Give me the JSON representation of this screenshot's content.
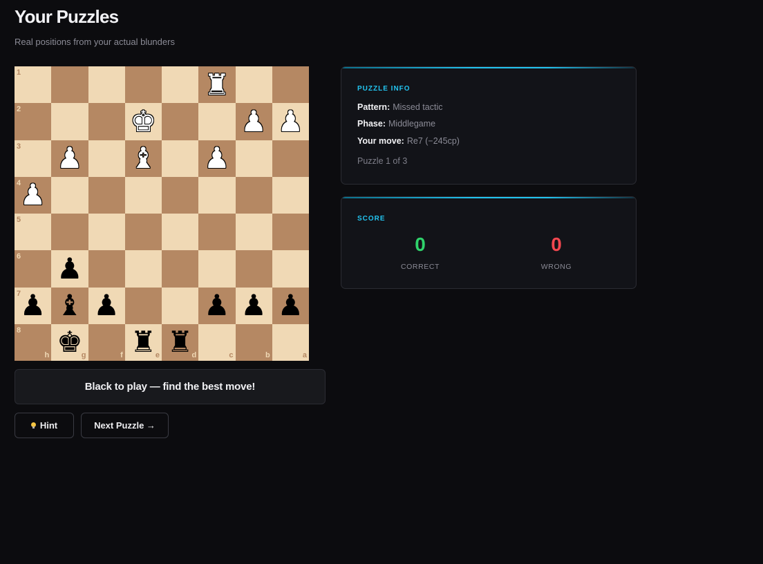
{
  "header": {
    "title": "Your Puzzles",
    "subtitle": "Real positions from your actual blunders"
  },
  "board": {
    "light_color": "#f0d9b5",
    "dark_color": "#b58863",
    "rank_labels": [
      "1",
      "2",
      "3",
      "4",
      "5",
      "6",
      "7",
      "8"
    ],
    "file_labels": [
      "h",
      "g",
      "f",
      "e",
      "d",
      "c",
      "b",
      "a"
    ],
    "rows": [
      [
        "",
        "",
        "",
        "",
        "",
        "wR",
        "",
        ""
      ],
      [
        "",
        "",
        "",
        "wK",
        "",
        "",
        "wP",
        "wP"
      ],
      [
        "",
        "wP",
        "",
        "wB",
        "",
        "wP",
        "",
        ""
      ],
      [
        "wP",
        "",
        "",
        "",
        "",
        "",
        "",
        ""
      ],
      [
        "",
        "",
        "",
        "",
        "",
        "",
        "",
        ""
      ],
      [
        "",
        "bP",
        "",
        "",
        "",
        "",
        "",
        ""
      ],
      [
        "bP",
        "bB",
        "bP",
        "",
        "",
        "bP",
        "bP",
        "bP"
      ],
      [
        "",
        "bK",
        "",
        "bR",
        "bR",
        "",
        "",
        ""
      ]
    ]
  },
  "status": {
    "text": "Black to play — find the best move!"
  },
  "buttons": {
    "hint_label": "Hint",
    "next_label": "Next Puzzle →"
  },
  "puzzle_info": {
    "heading": "PUZZLE INFO",
    "pattern_label": "Pattern:",
    "pattern_value": "Missed tactic",
    "phase_label": "Phase:",
    "phase_value": "Middlegame",
    "move_label": "Your move:",
    "move_value": "Re7 (−245cp)",
    "count": "Puzzle 1 of 3"
  },
  "score": {
    "heading": "SCORE",
    "correct_value": "0",
    "correct_label": "CORRECT",
    "wrong_value": "0",
    "wrong_label": "WRONG"
  },
  "colors": {
    "accent": "#22c4f0",
    "correct": "#2fd36b",
    "wrong": "#f2474f"
  }
}
